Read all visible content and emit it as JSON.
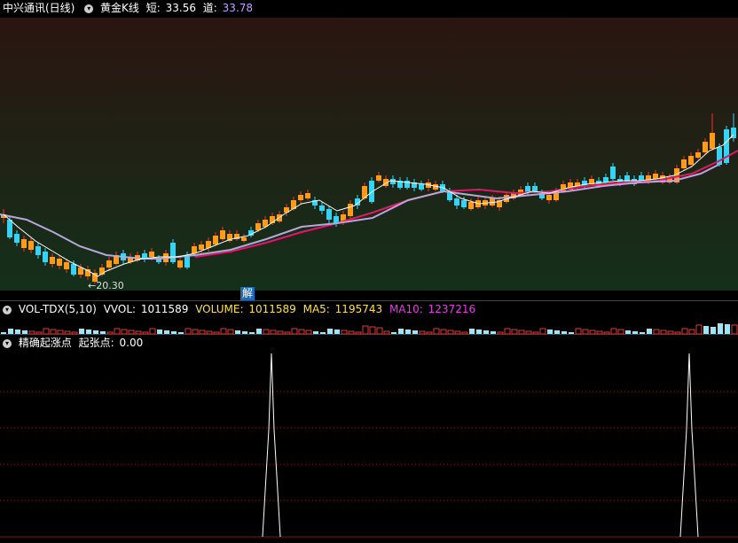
{
  "main_panel": {
    "stock_name": "中兴通讯(日线)",
    "indicator_name": "黄金K线",
    "short_label": "短:",
    "short_value": "33.56",
    "dao_label": "道:",
    "dao_value": "33.78",
    "min_price_label": "←20.30",
    "jie_button": "解"
  },
  "vol_panel": {
    "indicator": "VOL-TDX(5,10)",
    "vvol_label": "VVOL:",
    "vvol_value": "1011589",
    "volume_label": "VOLUME:",
    "volume_value": "1011589",
    "ma5_label": "MA5:",
    "ma5_value": "1195743",
    "ma10_label": "MA10:",
    "ma10_value": "1237216"
  },
  "ind_panel": {
    "indicator": "精确起涨点",
    "label": "起张点:",
    "value": "0.00"
  },
  "colors": {
    "up": "#ff9a1a",
    "down": "#36d3f5",
    "short_line": "#ffffff",
    "dao_line": "#b8a6d8",
    "long_line": "#e0186a",
    "vvol_text": "#ffffff",
    "volume_text": "#ffe04a",
    "ma5_text": "#ffe04a",
    "ma10_text": "#e040e0",
    "short_value_text": "#ffffff",
    "dao_value_text": "#c0a0ff"
  }
}
